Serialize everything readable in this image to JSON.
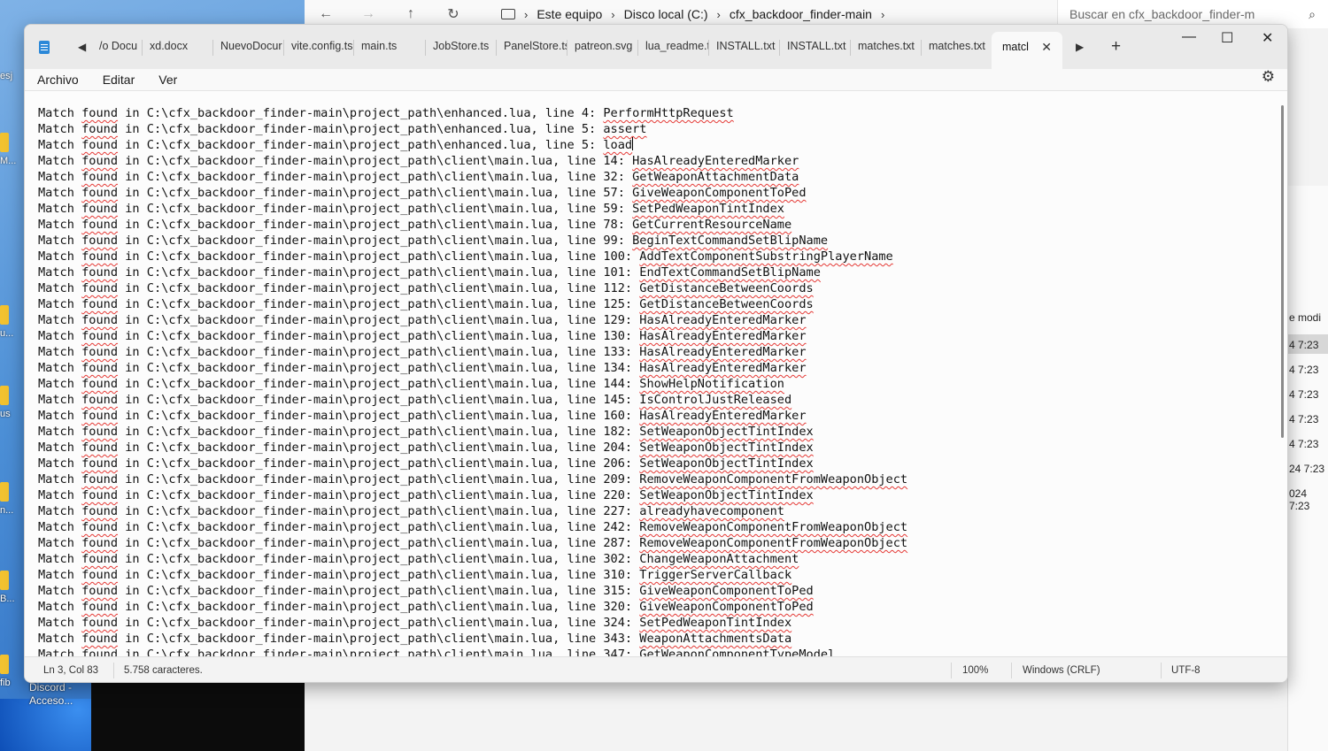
{
  "desktop": {
    "icon_labels": [
      "esj",
      "M...",
      "u...",
      "us",
      "n...",
      "B...",
      "fib"
    ],
    "discord_line1": "Discord -",
    "discord_line2": "Acceso..."
  },
  "explorer": {
    "crumbs": [
      "Este equipo",
      "Disco local (C:)",
      "cfx_backdoor_finder-main"
    ],
    "search_placeholder": "Buscar en cfx_backdoor_finder-m",
    "column_header": "e modi",
    "times": [
      "4 7:23",
      "4 7:23",
      "4 7:23",
      "4 7:23",
      "4 7:23",
      "24 7:23",
      "024 7:23"
    ]
  },
  "notepad": {
    "tab_scroll_left": "◀",
    "tab_scroll_right": "▶",
    "tabs": [
      "/o Docu",
      "xd.docx",
      "NuevoDocur",
      "vite.config.ts",
      "main.ts",
      "JobStore.ts",
      "PanelStore.ts",
      "patreon.svg",
      "lua_readme.t",
      "INSTALL.txt",
      "INSTALL.txt",
      "matches.txt",
      "matches.txt"
    ],
    "active_tab": "matcl",
    "new_tab": "+",
    "controls": {
      "minimize": "—",
      "maximize": "☐",
      "close": "✕"
    },
    "menu": {
      "file": "Archivo",
      "edit": "Editar",
      "view": "Ver"
    },
    "settings_icon": "⚙",
    "status": {
      "position": "Ln 3, Col 83",
      "chars": "5.758 caracteres.",
      "zoom": "100%",
      "eol": "Windows (CRLF)",
      "encoding": "UTF-8"
    },
    "lines": [
      {
        "p": "Match ",
        "w": "found",
        "m": " in C:\\cfx_backdoor_finder-main\\project_path\\enhanced.lua, line 4: ",
        "f": "PerformHttpRequest"
      },
      {
        "p": "Match ",
        "w": "found",
        "m": " in C:\\cfx_backdoor_finder-main\\project_path\\enhanced.lua, line 5: ",
        "f": "assert"
      },
      {
        "p": "Match ",
        "w": "found",
        "m": " in C:\\cfx_backdoor_finder-main\\project_path\\enhanced.lua, line 5: ",
        "f": "load"
      },
      {
        "p": "Match ",
        "w": "found",
        "m": " in C:\\cfx_backdoor_finder-main\\project_path\\client\\main.lua, line 14: ",
        "f": "HasAlreadyEnteredMarker"
      },
      {
        "p": "Match ",
        "w": "found",
        "m": " in C:\\cfx_backdoor_finder-main\\project_path\\client\\main.lua, line 32: ",
        "f": "GetWeaponAttachmentData"
      },
      {
        "p": "Match ",
        "w": "found",
        "m": " in C:\\cfx_backdoor_finder-main\\project_path\\client\\main.lua, line 57: ",
        "f": "GiveWeaponComponentToPed"
      },
      {
        "p": "Match ",
        "w": "found",
        "m": " in C:\\cfx_backdoor_finder-main\\project_path\\client\\main.lua, line 59: ",
        "f": "SetPedWeaponTintIndex"
      },
      {
        "p": "Match ",
        "w": "found",
        "m": " in C:\\cfx_backdoor_finder-main\\project_path\\client\\main.lua, line 78: ",
        "f": "GetCurrentResourceName"
      },
      {
        "p": "Match ",
        "w": "found",
        "m": " in C:\\cfx_backdoor_finder-main\\project_path\\client\\main.lua, line 99: ",
        "f": "BeginTextCommandSetBlipName"
      },
      {
        "p": "Match ",
        "w": "found",
        "m": " in C:\\cfx_backdoor_finder-main\\project_path\\client\\main.lua, line 100: ",
        "f": "AddTextComponentSubstringPlayerName"
      },
      {
        "p": "Match ",
        "w": "found",
        "m": " in C:\\cfx_backdoor_finder-main\\project_path\\client\\main.lua, line 101: ",
        "f": "EndTextCommandSetBlipName"
      },
      {
        "p": "Match ",
        "w": "found",
        "m": " in C:\\cfx_backdoor_finder-main\\project_path\\client\\main.lua, line 112: ",
        "f": "GetDistanceBetweenCoords"
      },
      {
        "p": "Match ",
        "w": "found",
        "m": " in C:\\cfx_backdoor_finder-main\\project_path\\client\\main.lua, line 125: ",
        "f": "GetDistanceBetweenCoords"
      },
      {
        "p": "Match ",
        "w": "found",
        "m": " in C:\\cfx_backdoor_finder-main\\project_path\\client\\main.lua, line 129: ",
        "f": "HasAlreadyEnteredMarker"
      },
      {
        "p": "Match ",
        "w": "found",
        "m": " in C:\\cfx_backdoor_finder-main\\project_path\\client\\main.lua, line 130: ",
        "f": "HasAlreadyEnteredMarker"
      },
      {
        "p": "Match ",
        "w": "found",
        "m": " in C:\\cfx_backdoor_finder-main\\project_path\\client\\main.lua, line 133: ",
        "f": "HasAlreadyEnteredMarker"
      },
      {
        "p": "Match ",
        "w": "found",
        "m": " in C:\\cfx_backdoor_finder-main\\project_path\\client\\main.lua, line 134: ",
        "f": "HasAlreadyEnteredMarker"
      },
      {
        "p": "Match ",
        "w": "found",
        "m": " in C:\\cfx_backdoor_finder-main\\project_path\\client\\main.lua, line 144: ",
        "f": "ShowHelpNotification"
      },
      {
        "p": "Match ",
        "w": "found",
        "m": " in C:\\cfx_backdoor_finder-main\\project_path\\client\\main.lua, line 145: ",
        "f": "IsControlJustReleased"
      },
      {
        "p": "Match ",
        "w": "found",
        "m": " in C:\\cfx_backdoor_finder-main\\project_path\\client\\main.lua, line 160: ",
        "f": "HasAlreadyEnteredMarker"
      },
      {
        "p": "Match ",
        "w": "found",
        "m": " in C:\\cfx_backdoor_finder-main\\project_path\\client\\main.lua, line 182: ",
        "f": "SetWeaponObjectTintIndex"
      },
      {
        "p": "Match ",
        "w": "found",
        "m": " in C:\\cfx_backdoor_finder-main\\project_path\\client\\main.lua, line 204: ",
        "f": "SetWeaponObjectTintIndex"
      },
      {
        "p": "Match ",
        "w": "found",
        "m": " in C:\\cfx_backdoor_finder-main\\project_path\\client\\main.lua, line 206: ",
        "f": "SetWeaponObjectTintIndex"
      },
      {
        "p": "Match ",
        "w": "found",
        "m": " in C:\\cfx_backdoor_finder-main\\project_path\\client\\main.lua, line 209: ",
        "f": "RemoveWeaponComponentFromWeaponObject"
      },
      {
        "p": "Match ",
        "w": "found",
        "m": " in C:\\cfx_backdoor_finder-main\\project_path\\client\\main.lua, line 220: ",
        "f": "SetWeaponObjectTintIndex"
      },
      {
        "p": "Match ",
        "w": "found",
        "m": " in C:\\cfx_backdoor_finder-main\\project_path\\client\\main.lua, line 227: ",
        "f": "alreadyhavecomponent"
      },
      {
        "p": "Match ",
        "w": "found",
        "m": " in C:\\cfx_backdoor_finder-main\\project_path\\client\\main.lua, line 242: ",
        "f": "RemoveWeaponComponentFromWeaponObject"
      },
      {
        "p": "Match ",
        "w": "found",
        "m": " in C:\\cfx_backdoor_finder-main\\project_path\\client\\main.lua, line 287: ",
        "f": "RemoveWeaponComponentFromWeaponObject"
      },
      {
        "p": "Match ",
        "w": "found",
        "m": " in C:\\cfx_backdoor_finder-main\\project_path\\client\\main.lua, line 302: ",
        "f": "ChangeWeaponAttachment"
      },
      {
        "p": "Match ",
        "w": "found",
        "m": " in C:\\cfx_backdoor_finder-main\\project_path\\client\\main.lua, line 310: ",
        "f": "TriggerServerCallback"
      },
      {
        "p": "Match ",
        "w": "found",
        "m": " in C:\\cfx_backdoor_finder-main\\project_path\\client\\main.lua, line 315: ",
        "f": "GiveWeaponComponentToPed"
      },
      {
        "p": "Match ",
        "w": "found",
        "m": " in C:\\cfx_backdoor_finder-main\\project_path\\client\\main.lua, line 320: ",
        "f": "GiveWeaponComponentToPed"
      },
      {
        "p": "Match ",
        "w": "found",
        "m": " in C:\\cfx_backdoor_finder-main\\project_path\\client\\main.lua, line 324: ",
        "f": "SetPedWeaponTintIndex"
      },
      {
        "p": "Match ",
        "w": "found",
        "m": " in C:\\cfx_backdoor_finder-main\\project_path\\client\\main.lua, line 343: ",
        "f": "WeaponAttachmentsData"
      },
      {
        "p": "Match ",
        "w": "found",
        "m": " in C:\\cfx_backdoor_finder-main\\project_path\\client\\main.lua, line 347: ",
        "f": "GetWeaponComponentTypeModel"
      }
    ]
  }
}
